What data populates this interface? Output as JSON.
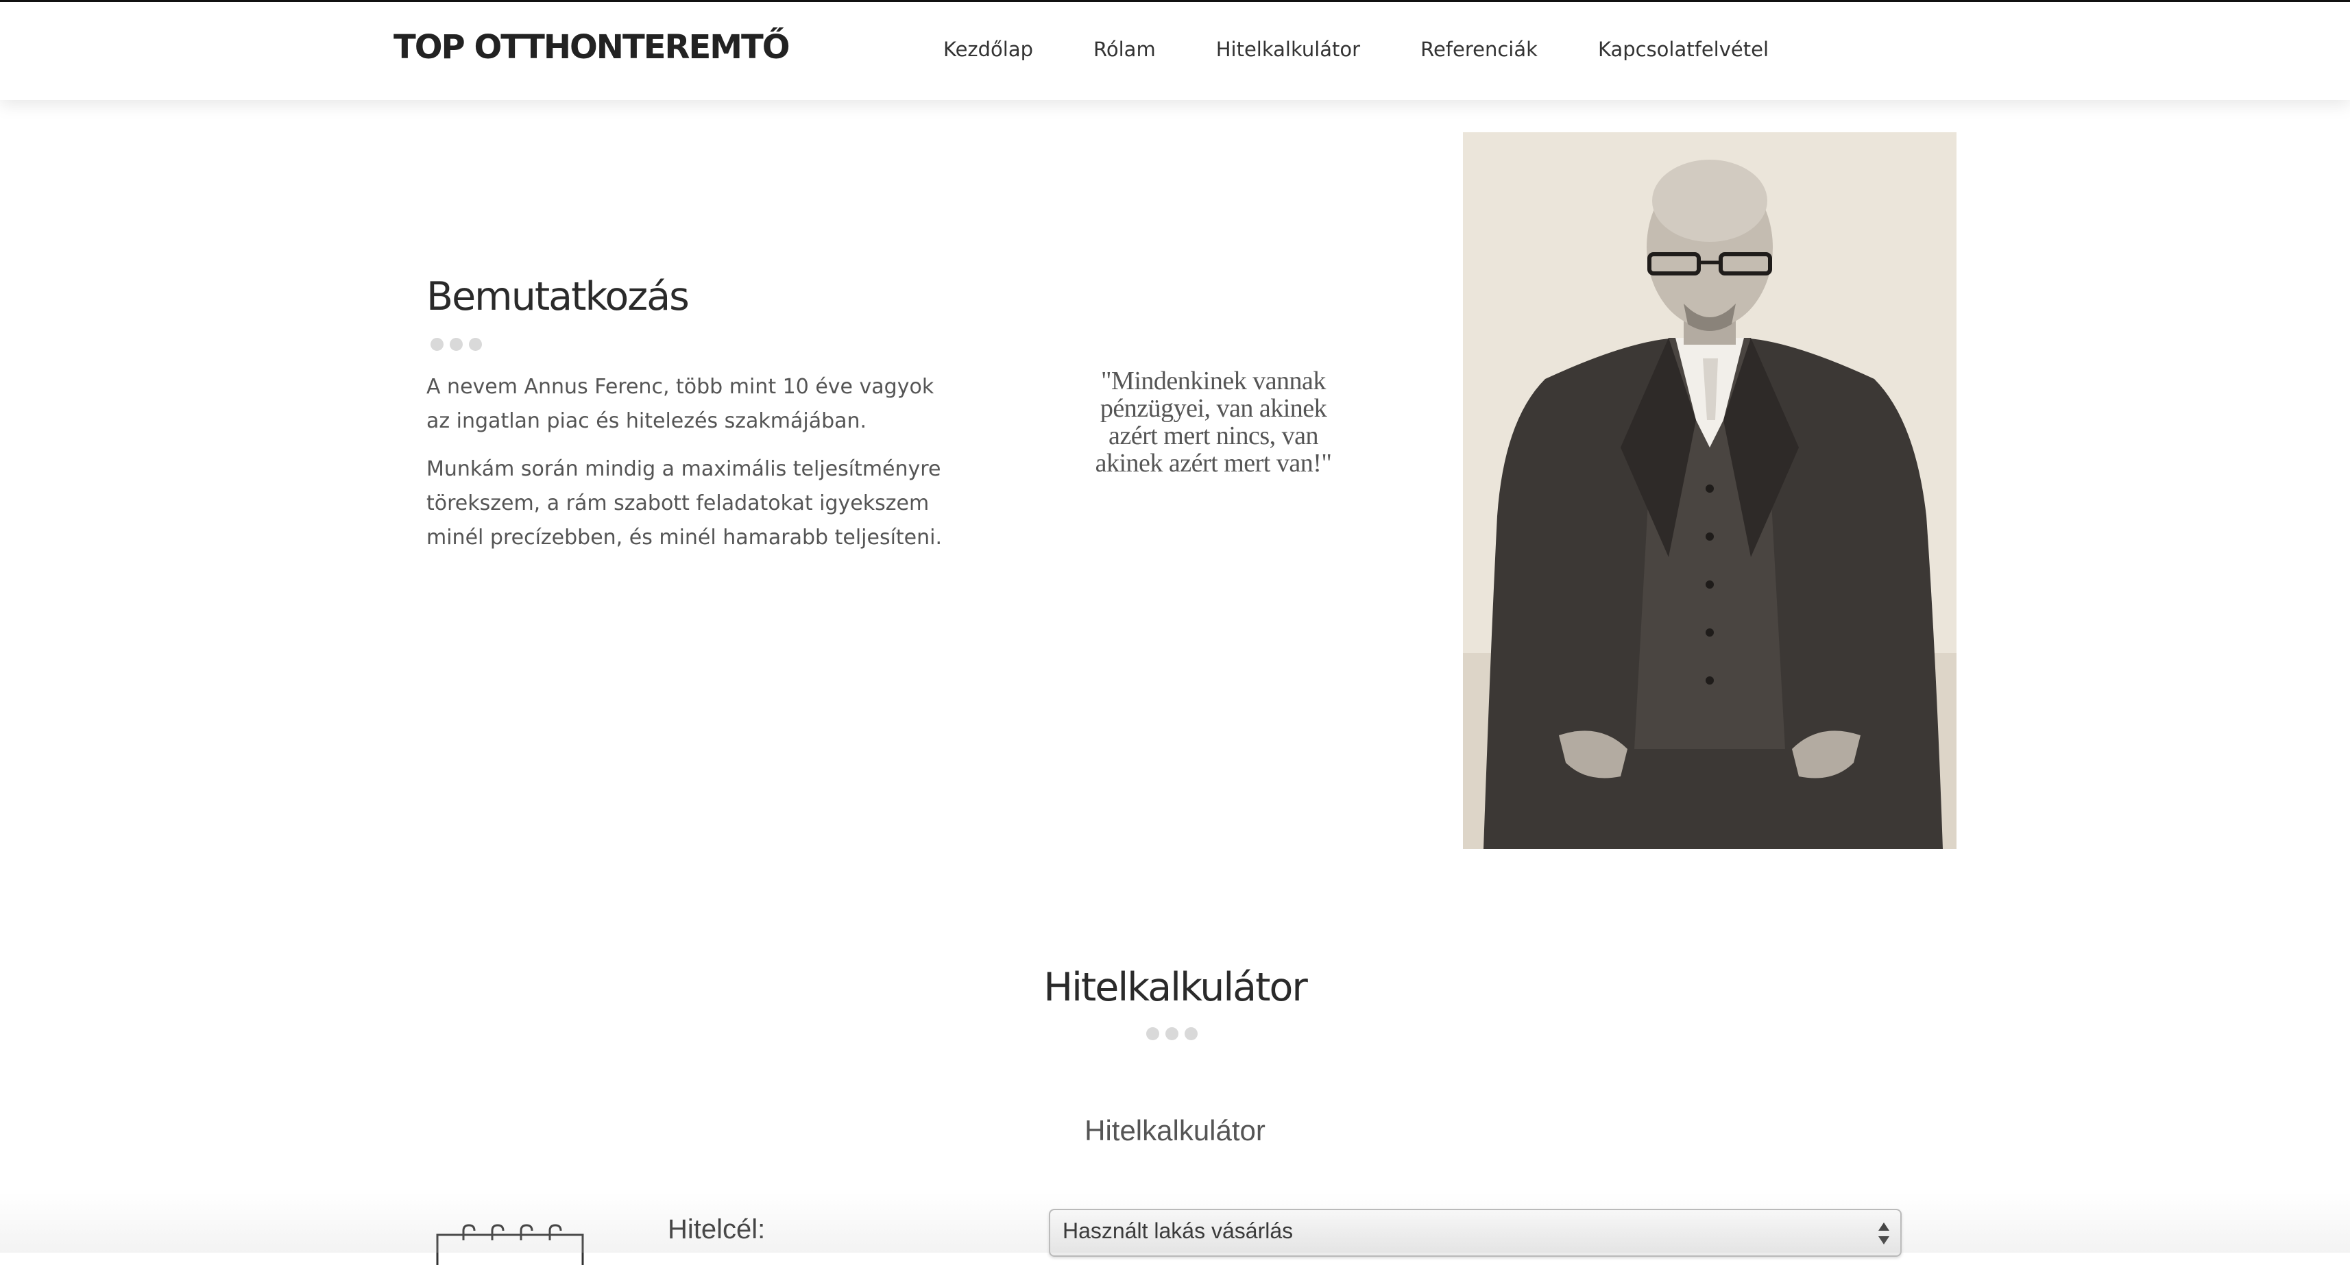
{
  "header": {
    "brand": "TOP OTTHONTEREMTŐ",
    "nav": [
      {
        "label": "Kezdőlap"
      },
      {
        "label": "Rólam"
      },
      {
        "label": "Hitelkalkulátor"
      },
      {
        "label": "Referenciák"
      },
      {
        "label": "Kapcsolatfelvétel"
      }
    ]
  },
  "intro": {
    "title": "Bemutatkozás",
    "paragraphs": [
      "A nevem Annus Ferenc, több mint 10 éve vagyok az ingatlan piac és hitelezés szakmájában.",
      "Munkám során mindig a maximális teljesítményre törekszem, a rám szabott feladatokat igyekszem minél precízebben, és minél hamarabb teljesíteni."
    ],
    "quote": "\"Mindenkinek vannak pénzügyei, van akinek azért mert nincs, van akinek azért mert van!\""
  },
  "calculator": {
    "heading": "Hitelkalkulátor",
    "subheading": "Hitelkalkulátor",
    "field_label": "Hitelcél:",
    "selected_option": "Használt lakás vásárlás"
  },
  "colors": {
    "text_dark": "#2a2a2a",
    "text_body": "#555555",
    "dot_gray": "#d9d9d9"
  },
  "icons": {
    "portrait": "man-in-suit-photo",
    "calendar": "calendar-icon",
    "select_arrow": "updown-arrows-icon"
  }
}
